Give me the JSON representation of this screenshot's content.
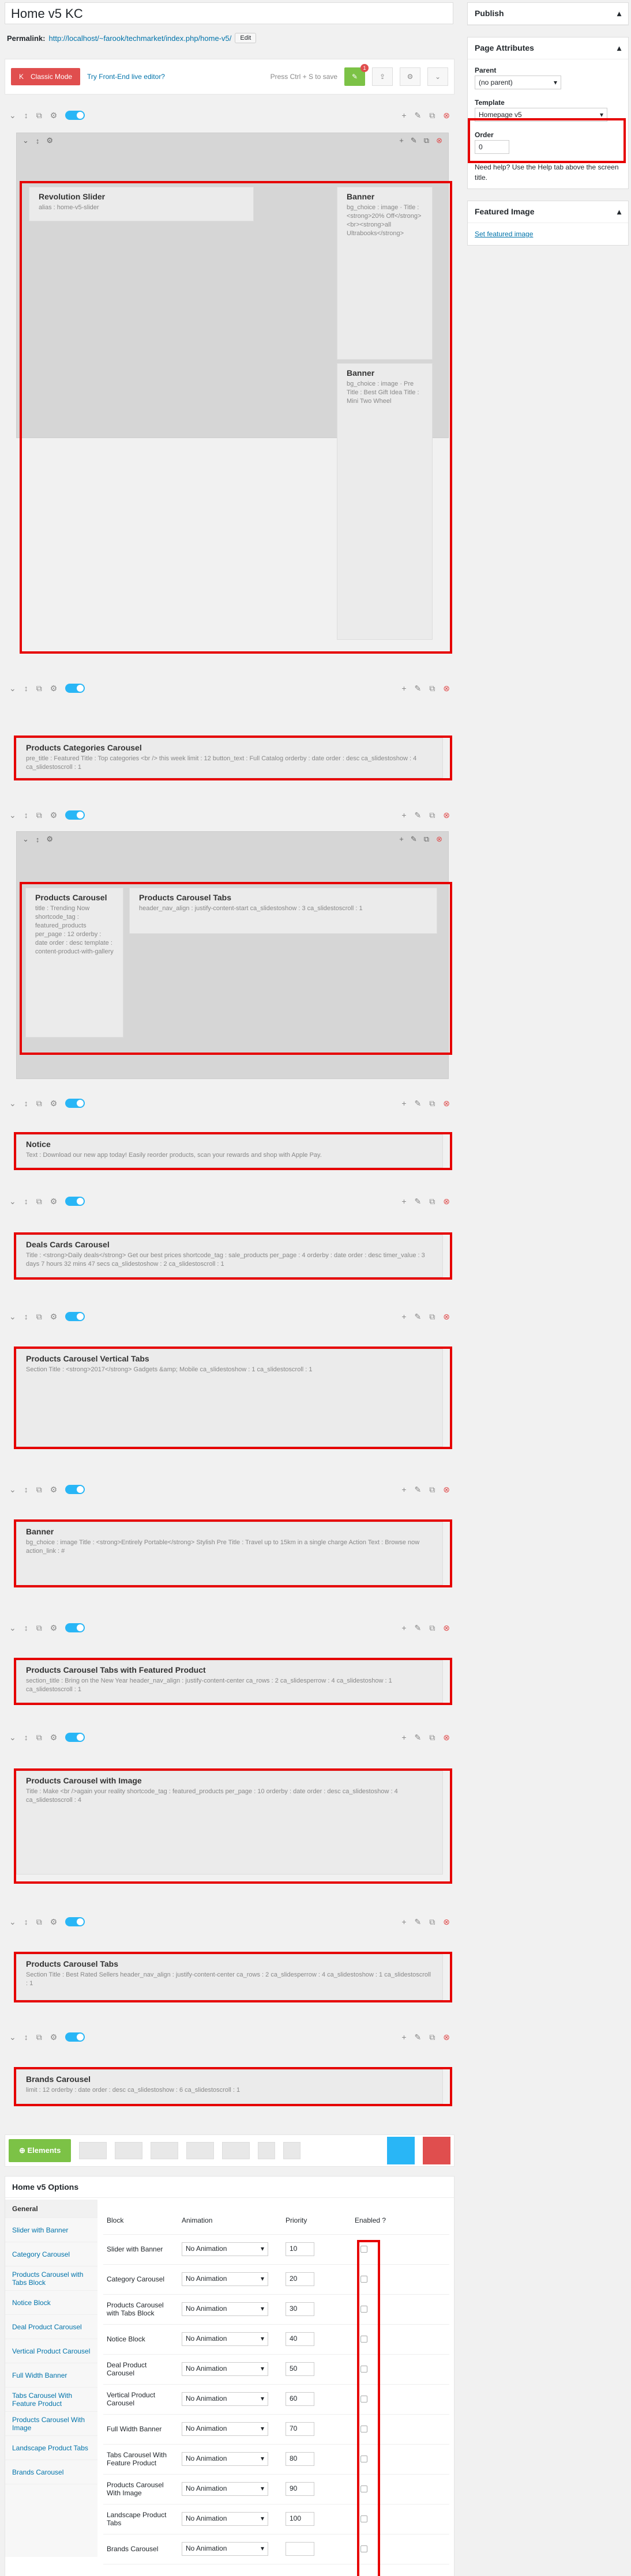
{
  "post": {
    "title": "Home v5 KC",
    "permalink_label": "Permalink:",
    "permalink_url": "http://localhost/~farook/techmarket/index.php/home-v5/",
    "edit": "Edit"
  },
  "kc": {
    "classic": "Classic Mode",
    "frontend": "Try Front-End live editor?",
    "hint": "Press Ctrl + S to save",
    "notice_count": "1"
  },
  "rows": [
    {
      "elements": [
        {
          "title": "Revolution Slider",
          "params": "alias : home-v5-slider"
        },
        {
          "title": "Banner",
          "params": "bg_choice : image · Title : <strong>20% Off</strong><br><strong>all Ultrabooks</strong>"
        },
        {
          "title": "Banner",
          "params": "bg_choice : image · Pre Title : Best Gift Idea Title : Mini Two Wheel"
        }
      ]
    },
    {
      "elements": [
        {
          "title": "Products Categories Carousel",
          "params": "pre_title : Featured  Title : Top categories <br /> this week  limit : 12  button_text : Full Catalog  orderby : date  order : desc  ca_slidestoshow : 4  ca_slidestoscroll : 1"
        }
      ]
    },
    {
      "elements": [
        {
          "title": "Products Carousel",
          "params": "title : Trending Now  shortcode_tag : featured_products  per_page : 12  orderby : date  order : desc  template : content-product-with-gallery"
        },
        {
          "title": "Products Carousel Tabs",
          "params": "header_nav_align : justify-content-start  ca_slidestoshow : 3  ca_slidestoscroll : 1"
        }
      ]
    },
    {
      "elements": [
        {
          "title": "Notice",
          "params": "Text : Download our new app today! Easily reorder products, scan your rewards and shop with Apple Pay."
        }
      ]
    },
    {
      "elements": [
        {
          "title": "Deals Cards Carousel",
          "params": "Title : <strong>Daily deals</strong> Get our best prices  shortcode_tag : sale_products  per_page : 4  orderby : date  order : desc  timer_value : 3 days 7 hours 32 mins 47 secs  ca_slidestoshow : 2  ca_slidestoscroll : 1"
        }
      ]
    },
    {
      "elements": [
        {
          "title": "Products Carousel Vertical Tabs",
          "params": "Section Title : <strong>2017</strong> Gadgets &amp; Mobile  ca_slidestoshow : 1  ca_slidestoscroll : 1"
        }
      ]
    },
    {
      "elements": [
        {
          "title": "Banner",
          "params": "bg_choice : image  Title : <strong>Entirely Portable</strong> Stylish Pre Title : Travel up to 15km in a single charge  Action Text : Browse now  action_link : #"
        }
      ]
    },
    {
      "elements": [
        {
          "title": "Products Carousel Tabs with Featured Product",
          "params": "section_title : Bring on the New Year  header_nav_align : justify-content-center  ca_rows : 2  ca_slidesperrow : 4  ca_slidestoshow : 1  ca_slidestoscroll : 1"
        }
      ]
    },
    {
      "elements": [
        {
          "title": "Products Carousel with Image",
          "params": "Title : Make <br />again your reality  shortcode_tag : featured_products  per_page : 10  orderby : date  order : desc  ca_slidestoshow : 4  ca_slidestoscroll : 4"
        }
      ]
    },
    {
      "elements": [
        {
          "title": "Products Carousel Tabs",
          "params": "Section Title : Best Rated Sellers  header_nav_align : justify-content-center  ca_rows : 2  ca_slidesperrow : 4  ca_slidestoshow : 1  ca_slidestoscroll : 1"
        }
      ]
    },
    {
      "elements": [
        {
          "title": "Brands Carousel",
          "params": "limit : 12  orderby : date  order : desc  ca_slidestoshow : 6  ca_slidestoscroll : 1"
        }
      ]
    }
  ],
  "sidebar": {
    "publish": "Publish",
    "page_attr": "Page Attributes",
    "parent_label": "Parent",
    "parent_value": "(no parent)",
    "template_label": "Template",
    "template_value": "Homepage v5",
    "order_label": "Order",
    "order_value": "0",
    "help": "Need help? Use the Help tab above the screen title.",
    "featured": "Featured Image",
    "set_featured": "Set featured image"
  },
  "bottom": {
    "elements": "Elements"
  },
  "options": {
    "title": "Home v5 Options",
    "tabs": [
      "General",
      "Slider with Banner",
      "Category Carousel",
      "Products Carousel with Tabs Block",
      "Notice Block",
      "Deal Product Carousel",
      "Vertical Product Carousel",
      "Full Width Banner",
      "Tabs Carousel With Feature Product",
      "Products Carousel With Image",
      "Landscape Product Tabs",
      "Brands Carousel"
    ],
    "headers": {
      "block": "Block",
      "anim": "Animation",
      "prio": "Priority",
      "enabled": "Enabled ?"
    },
    "rows": [
      {
        "block": "Slider with Banner",
        "anim": "No Animation",
        "prio": "10"
      },
      {
        "block": "Category Carousel",
        "anim": "No Animation",
        "prio": "20"
      },
      {
        "block": "Products Carousel with Tabs Block",
        "anim": "No Animation",
        "prio": "30"
      },
      {
        "block": "Notice Block",
        "anim": "No Animation",
        "prio": "40"
      },
      {
        "block": "Deal Product Carousel",
        "anim": "No Animation",
        "prio": "50"
      },
      {
        "block": "Vertical Product Carousel",
        "anim": "No Animation",
        "prio": "60"
      },
      {
        "block": "Full Width Banner",
        "anim": "No Animation",
        "prio": "70"
      },
      {
        "block": "Tabs Carousel With Feature Product",
        "anim": "No Animation",
        "prio": "80"
      },
      {
        "block": "Products Carousel With Image",
        "anim": "No Animation",
        "prio": "90"
      },
      {
        "block": "Landscape Product Tabs",
        "anim": "No Animation",
        "prio": "100"
      },
      {
        "block": "Brands Carousel",
        "anim": "No Animation",
        "prio": ""
      }
    ]
  }
}
